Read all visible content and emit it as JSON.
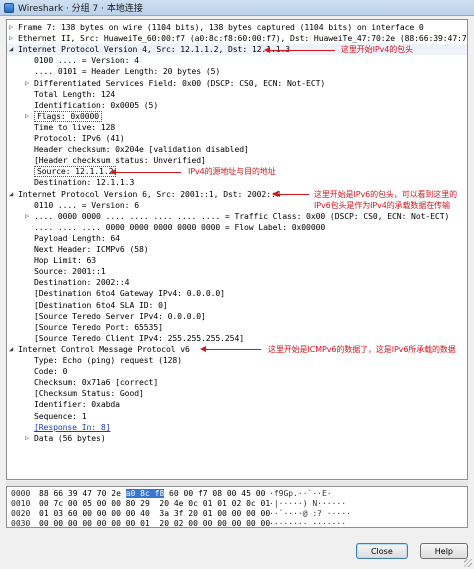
{
  "window": {
    "title": "Wireshark · 分组 7 · 本地连接"
  },
  "tree": [
    {
      "indent": 0,
      "exp": "+",
      "text": "Frame 7: 138 bytes on wire (1104 bits), 138 bytes captured (1104 bits) on interface 0"
    },
    {
      "indent": 0,
      "exp": "+",
      "text": "Ethernet II, Src: HuaweiTe_60:00:f7 (a0:8c:f8:60:00:f7), Dst: HuaweiTe_47:70:2e (88:66:39:47:70:2e)"
    },
    {
      "indent": 0,
      "exp": "-",
      "text": "Internet Protocol Version 4, Src: 12.1.1.2, Dst: 12.1.1.3"
    },
    {
      "indent": 1,
      "exp": "",
      "text": "0100 .... = Version: 4"
    },
    {
      "indent": 1,
      "exp": "",
      "text": ".... 0101 = Header Length: 20 bytes (5)"
    },
    {
      "indent": 1,
      "exp": "+",
      "text": "Differentiated Services Field: 0x00 (DSCP: CS0, ECN: Not-ECT)"
    },
    {
      "indent": 1,
      "exp": "",
      "text": "Total Length: 124"
    },
    {
      "indent": 1,
      "exp": "",
      "text": "Identification: 0x0005 (5)"
    },
    {
      "indent": 1,
      "exp": "+",
      "text": "Flags: 0x0000",
      "style": "boxed"
    },
    {
      "indent": 1,
      "exp": "",
      "text": "Time to live: 128"
    },
    {
      "indent": 1,
      "exp": "",
      "text": "Protocol: IPv6 (41)"
    },
    {
      "indent": 1,
      "exp": "",
      "text": "Header checksum: 0x204e [validation disabled]"
    },
    {
      "indent": 1,
      "exp": "",
      "text": "[Header checksum status: Unverified]"
    },
    {
      "indent": 1,
      "exp": "",
      "text": "Source: 12.1.1.2",
      "style": "boxed"
    },
    {
      "indent": 1,
      "exp": "",
      "text": "Destination: 12.1.1.3"
    },
    {
      "indent": 0,
      "exp": "-",
      "text": "Internet Protocol Version 6, Src: 2001::1, Dst: 2002::4"
    },
    {
      "indent": 1,
      "exp": "",
      "text": "0110 .... = Version: 6"
    },
    {
      "indent": 1,
      "exp": "+",
      "text": ".... 0000 0000 .... .... .... .... .... = Traffic Class: 0x00 (DSCP: CS0, ECN: Not-ECT)"
    },
    {
      "indent": 1,
      "exp": "",
      "text": ".... .... .... 0000 0000 0000 0000 0000 = Flow Label: 0x00000"
    },
    {
      "indent": 1,
      "exp": "",
      "text": "Payload Length: 64"
    },
    {
      "indent": 1,
      "exp": "",
      "text": "Next Header: ICMPv6 (58)"
    },
    {
      "indent": 1,
      "exp": "",
      "text": "Hop Limit: 63"
    },
    {
      "indent": 1,
      "exp": "",
      "text": "Source: 2001::1"
    },
    {
      "indent": 1,
      "exp": "",
      "text": "Destination: 2002::4"
    },
    {
      "indent": 1,
      "exp": "",
      "text": "[Destination 6to4 Gateway IPv4: 0.0.0.0]"
    },
    {
      "indent": 1,
      "exp": "",
      "text": "[Destination 6to4 SLA ID: 0]"
    },
    {
      "indent": 1,
      "exp": "",
      "text": "[Source Teredo Server IPv4: 0.0.0.0]"
    },
    {
      "indent": 1,
      "exp": "",
      "text": "[Source Teredo Port: 65535]"
    },
    {
      "indent": 1,
      "exp": "",
      "text": "[Source Teredo Client IPv4: 255.255.255.254]"
    },
    {
      "indent": 0,
      "exp": "-",
      "text": "Internet Control Message Protocol v6"
    },
    {
      "indent": 1,
      "exp": "",
      "text": "Type: Echo (ping) request (128)"
    },
    {
      "indent": 1,
      "exp": "",
      "text": "Code: 0"
    },
    {
      "indent": 1,
      "exp": "",
      "text": "Checksum: 0x71a6 [correct]"
    },
    {
      "indent": 1,
      "exp": "",
      "text": "[Checksum Status: Good]"
    },
    {
      "indent": 1,
      "exp": "",
      "text": "Identifier: 0xabda"
    },
    {
      "indent": 1,
      "exp": "",
      "text": "Sequence: 1"
    },
    {
      "indent": 1,
      "exp": "",
      "text": "[Response In: 8]",
      "style": "link"
    },
    {
      "indent": 1,
      "exp": "+",
      "text": "Data (56 bytes)"
    }
  ],
  "annotations": [
    {
      "row": 2,
      "lines": [
        "这里开始IPv4的包头"
      ]
    },
    {
      "row": 13,
      "lines": [
        "IPv4的源地址与目的地址"
      ]
    },
    {
      "row": 15,
      "lines": [
        "这里开始是IPv6的包头，可以看到这里的",
        "IPv6包头是作为IPv4的承载数据在传输"
      ]
    },
    {
      "row": 29,
      "lines": [
        "这里开始是ICMPv6的数据了，这是IPv6所承载的数据"
      ]
    }
  ],
  "hex": [
    {
      "offset": "0000",
      "before": "88 66 39 47 70 2e ",
      "highlight": "a0 8c f8",
      "after": " 60 00 f7 08 00 45 00",
      "ascii": "·f9Gp.",
      "ascii_hl": "··`",
      "ascii_after": "··E·"
    },
    {
      "offset": "0010",
      "before": "00 7c 00 05 00 00 80 29  20 4e 0c 01 01 02 0c 01",
      "highlight": "",
      "after": "",
      "ascii": "·|·····)",
      "ascii_hl": "",
      "ascii_after": " N······"
    },
    {
      "offset": "0020",
      "before": "01 03 60 00 00 00 00 40  3a 3f 20 01 00 00 00 00",
      "highlight": "",
      "after": "",
      "ascii": "··`····@",
      "ascii_hl": "",
      "ascii_after": " :? ·····"
    },
    {
      "offset": "0030",
      "before": "00 00 00 00 00 00 00 01  20 02 00 00 00 00 00 00",
      "highlight": "",
      "after": "",
      "ascii": "········",
      "ascii_hl": "",
      "ascii_after": " ·······"
    }
  ],
  "buttons": {
    "close": "Close",
    "help": "Help"
  }
}
